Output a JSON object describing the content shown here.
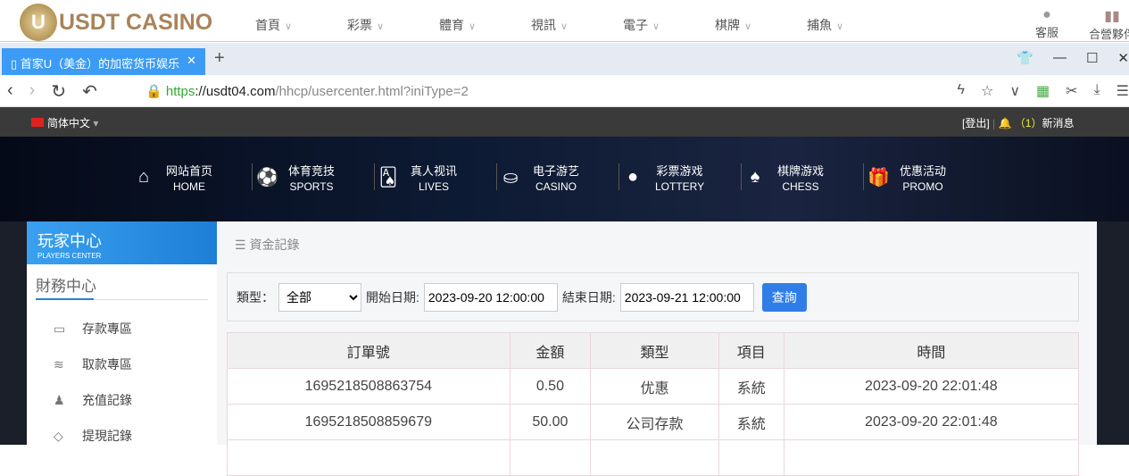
{
  "site": {
    "logo": "USDT CASINO",
    "logo_mark": "U",
    "nav": [
      "首頁",
      "彩票",
      "體育",
      "視訊",
      "電子",
      "棋牌",
      "捕魚"
    ],
    "service": "客服",
    "partner": "合營夥伴"
  },
  "browser": {
    "tab_title": "首家U（美金）的加密货币娱乐",
    "url_scheme": "https",
    "url_host": "://usdt04.com",
    "url_path": "/hhcp/usercenter.html?iniType=2"
  },
  "userbar": {
    "language": "简体中文",
    "logout": "[登出]",
    "msg_count": "（1）",
    "msg_label": "新消息"
  },
  "main_nav": [
    {
      "icon": "home-icon",
      "glyph": "⌂",
      "cn": "网站首页",
      "en": "HOME"
    },
    {
      "icon": "sports-ball-icon",
      "glyph": "⚽",
      "cn": "体育竞技",
      "en": "SPORTS"
    },
    {
      "icon": "cards-icon",
      "glyph": "🂡",
      "cn": "真人视讯",
      "en": "LIVES"
    },
    {
      "icon": "casino-chip-icon",
      "glyph": "⛀",
      "cn": "电子游艺",
      "en": "CASINO"
    },
    {
      "icon": "lottery-balls-icon",
      "glyph": "●",
      "cn": "彩票游戏",
      "en": "LOTTERY"
    },
    {
      "icon": "spade-icon",
      "glyph": "♠",
      "cn": "棋牌游戏",
      "en": "CHESS"
    },
    {
      "icon": "gift-icon",
      "glyph": "🎁",
      "cn": "优惠活动",
      "en": "PROMO"
    }
  ],
  "sidebar": {
    "title": "玩家中心",
    "subtitle": "PLAYERS CENTER",
    "section": "財務中心",
    "items": [
      {
        "label": "存款專區",
        "glyph": "▭"
      },
      {
        "label": "取款專區",
        "glyph": "≋"
      },
      {
        "label": "充值記錄",
        "glyph": "♟"
      },
      {
        "label": "提現記錄",
        "glyph": "◇"
      }
    ]
  },
  "page": {
    "breadcrumb": "資金記錄",
    "type_label": "類型：",
    "type_value": "全部",
    "start_label": "開始日期:",
    "start_value": "2023-09-20 12:00:00",
    "end_label": "結束日期:",
    "end_value": "2023-09-21 12:00:00",
    "query": "查詢"
  },
  "table": {
    "headers": [
      "訂單號",
      "金額",
      "類型",
      "項目",
      "時間"
    ],
    "rows": [
      [
        "1695218508863754",
        "0.50",
        "优惠",
        "系統",
        "2023-09-20 22:01:48"
      ],
      [
        "1695218508859679",
        "50.00",
        "公司存款",
        "系統",
        "2023-09-20 22:01:48"
      ]
    ]
  }
}
